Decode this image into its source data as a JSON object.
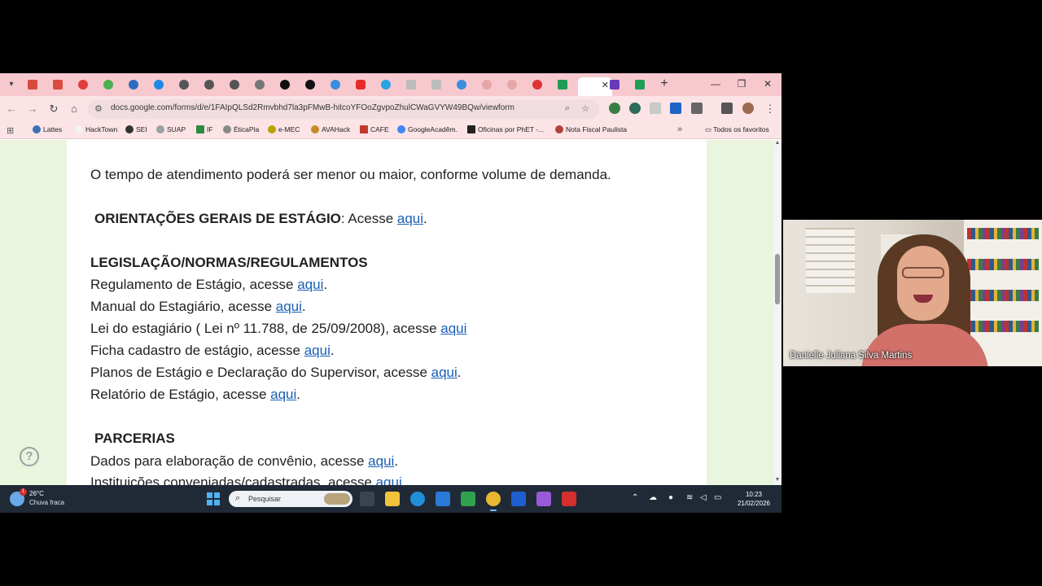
{
  "browser": {
    "address": {
      "url": "docs.google.com/forms/d/e/1FAIpQLSd2Rmvbhd7la3pFMwB-hitcoYFOoZgvpoZhulCWaGVYW49BQw/viewform"
    },
    "bookmarks": [
      {
        "label": "Lattes",
        "icon": "lattes-icon",
        "color": "#3b6fb6"
      },
      {
        "label": "HackTown",
        "icon": "hacktown-icon",
        "color": "#f2f2f2"
      },
      {
        "label": "SEI",
        "icon": "sei-icon",
        "color": "#333333"
      },
      {
        "label": "SUAP",
        "icon": "suap-icon",
        "color": "#9aa0a6"
      },
      {
        "label": "IF",
        "icon": "if-icon",
        "color": "#2e8b3d"
      },
      {
        "label": "ÉticaPla",
        "icon": "eticapla-icon",
        "color": "#888888"
      },
      {
        "label": "e-MEC",
        "icon": "emec-icon",
        "color": "#b8a100"
      },
      {
        "label": "AVAHack",
        "icon": "avahack-icon",
        "color": "#c58b2a"
      },
      {
        "label": "CAFE",
        "icon": "cafe-icon",
        "color": "#c0392b"
      },
      {
        "label": "GoogleAcadêm.",
        "icon": "google-scholar-icon",
        "color": "#4285f4"
      },
      {
        "label": "Oficinas por PhET -...",
        "icon": "phet-icon",
        "color": "#222222"
      },
      {
        "label": "Nota Fiscal Paulista",
        "icon": "nfp-icon",
        "color": "#b0413e"
      }
    ],
    "all_bookmarks_label": "Todos os favoritos"
  },
  "page": {
    "intro": "O tempo de atendimento poderá ser menor ou maior, conforme volume de demanda.",
    "orientacoes": {
      "title": "ORIENTAÇÕES GERAIS DE ESTÁGIO",
      "prefix": ": Acesse ",
      "link": "aqui",
      "suffix": "."
    },
    "legislacao_title": "LEGISLAÇÃO/NORMAS/REGULAMENTOS",
    "legislacao_items": [
      {
        "text": "Regulamento de Estágio, acesse ",
        "link": "aqui",
        "suffix": "."
      },
      {
        "text": "Manual do Estagiário, acesse ",
        "link": "aqui",
        "suffix": "."
      },
      {
        "text": "Lei do estagiário ( Lei nº 11.788, de 25/09/2008), acesse ",
        "link": "aqui",
        "suffix": ""
      },
      {
        "text": "Ficha cadastro de estágio, acesse ",
        "link": "aqui",
        "suffix": "."
      },
      {
        "text": "Planos de Estágio e Declaração do Supervisor, acesse ",
        "link": "aqui",
        "suffix": "."
      },
      {
        "text": "Relatório de Estágio, acesse ",
        "link": "aqui",
        "suffix": "."
      }
    ],
    "parcerias_title": "PARCERIAS",
    "parcerias_items": [
      {
        "text": "Dados para elaboração de convênio, acesse ",
        "link": "aqui",
        "suffix": "."
      },
      {
        "text": "Instituições conveniadas/cadastradas, acesse ",
        "link": "aqui",
        "suffix": ""
      }
    ],
    "help_symbol": "?",
    "colors": {
      "page_bg": "#e9f5dc",
      "link": "#1a5fb4",
      "tabstrip": "#f7c9cf"
    }
  },
  "taskbar": {
    "weather_temp": "26°C",
    "weather_desc": "Chuva fraca",
    "weather_badge": "1",
    "search_placeholder": "Pesquisar",
    "time": "10:23",
    "date": "21/02/2026"
  },
  "camera": {
    "participant_name": "Danielle Juliana Silva Martins"
  }
}
